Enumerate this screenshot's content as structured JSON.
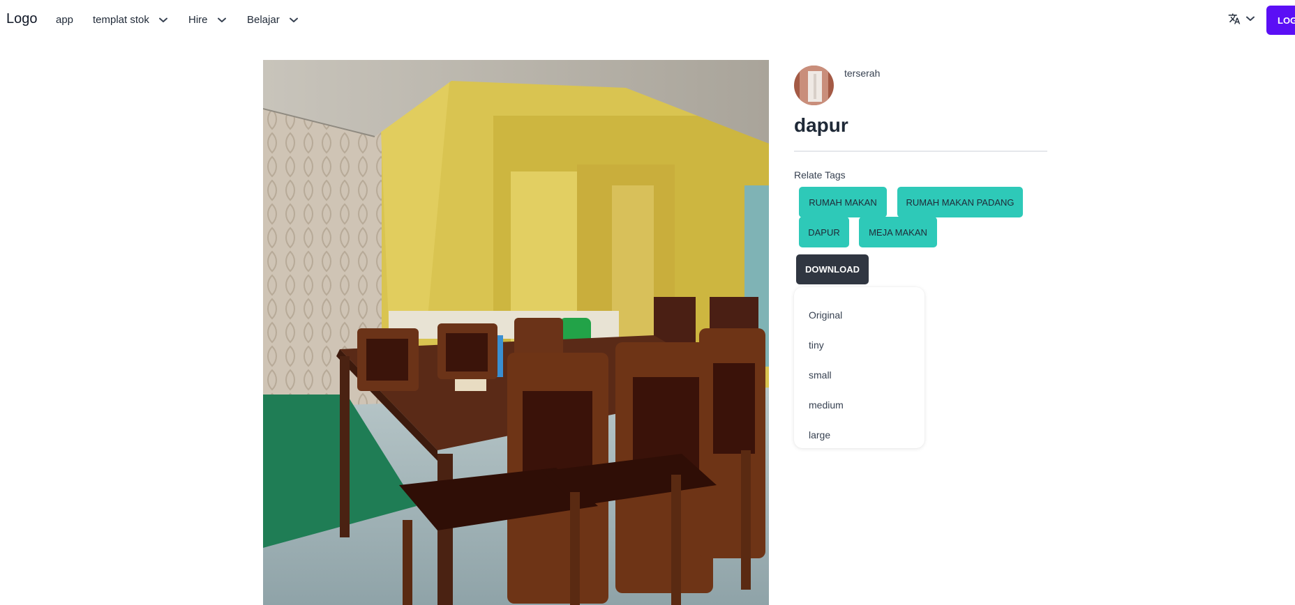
{
  "nav": {
    "logo": "Logo",
    "items": [
      {
        "label": "app",
        "has_dropdown": false
      },
      {
        "label": "templat stok",
        "has_dropdown": true
      },
      {
        "label": "Hire",
        "has_dropdown": true
      },
      {
        "label": "Belajar",
        "has_dropdown": true
      }
    ],
    "language_icon": "translate-icon",
    "login_label": "LOGIN",
    "accent_color": "#5b0ff5"
  },
  "photo": {
    "subject": "dining-room-photo"
  },
  "author": {
    "username": "terserah",
    "avatar_icon": "avatar"
  },
  "title": "dapur",
  "tags": {
    "label": "Relate Tags",
    "items": [
      "RUMAH MAKAN",
      "RUMAH MAKAN PADANG",
      "DAPUR",
      "MEJA MAKAN"
    ],
    "color": "#2ec9b8"
  },
  "download": {
    "label": "DOWNLOAD",
    "color": "#303641",
    "options": [
      "Original",
      "tiny",
      "small",
      "medium",
      "large"
    ]
  }
}
